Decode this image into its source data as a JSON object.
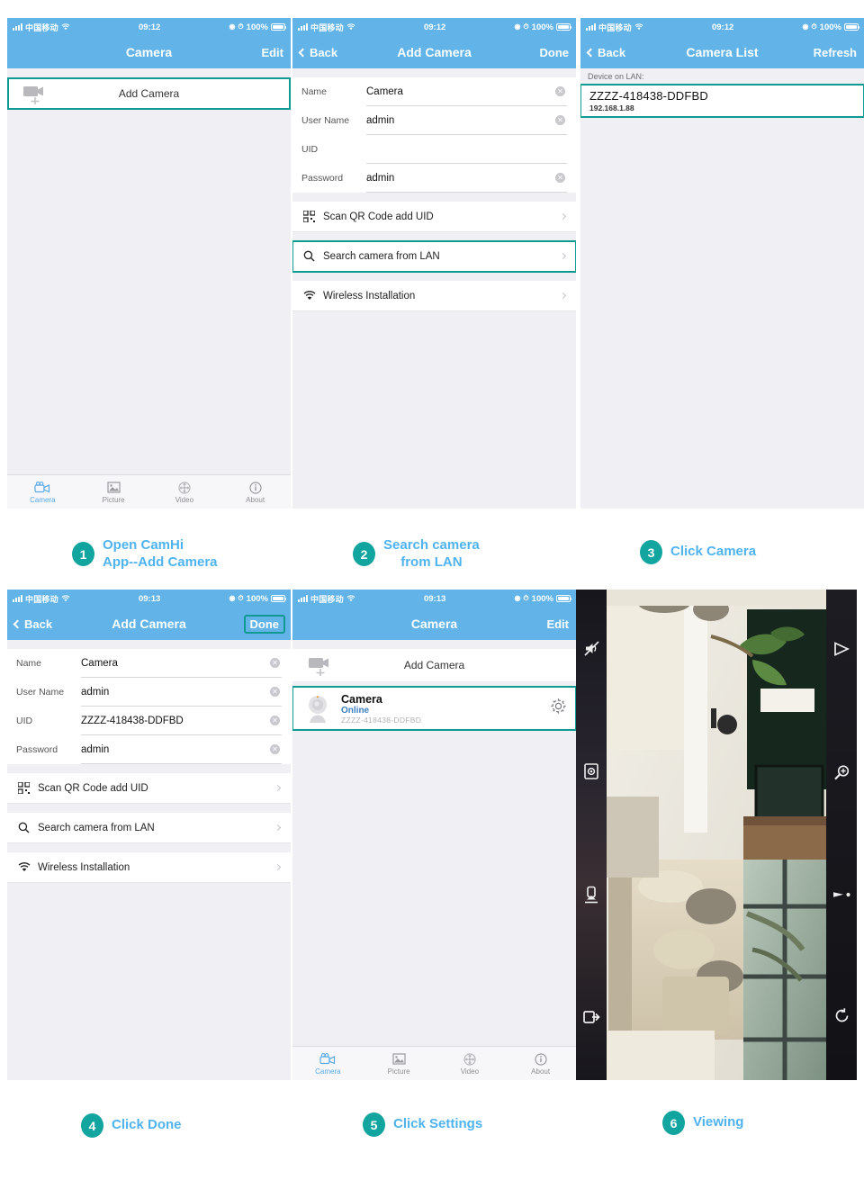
{
  "statusbar": {
    "carrier": "中国移动",
    "time_0912": "09:12",
    "time_0913": "09:13",
    "battery": "100%",
    "signal_icon": "signal-bars-icon",
    "wifi_icon": "wifi-icon",
    "location_icon": "location-icon",
    "alarm_icon": "alarm-icon",
    "battery_icon": "battery-icon"
  },
  "tabbar": {
    "tabs": [
      {
        "label": "Camera",
        "icon": "video-camera-icon",
        "active": true
      },
      {
        "label": "Picture",
        "icon": "photo-icon",
        "active": false
      },
      {
        "label": "Video",
        "icon": "film-reel-icon",
        "active": false
      },
      {
        "label": "About",
        "icon": "info-circle-icon",
        "active": false
      }
    ]
  },
  "panel1": {
    "nav": {
      "title": "Camera",
      "right": "Edit"
    },
    "add_camera_label": "Add Camera"
  },
  "panel2": {
    "nav": {
      "back": "Back",
      "title": "Add Camera",
      "right": "Done"
    },
    "form": [
      {
        "label": "Name",
        "value": "Camera",
        "clear": true
      },
      {
        "label": "User Name",
        "value": "admin",
        "clear": true
      },
      {
        "label": "UID",
        "value": "",
        "clear": false
      },
      {
        "label": "Password",
        "value": "admin",
        "clear": true
      }
    ],
    "menu": [
      {
        "label": "Scan QR Code add UID",
        "icon": "qr-code-icon",
        "highlight": false
      },
      {
        "label": "Search camera from LAN",
        "icon": "search-icon",
        "highlight": true
      },
      {
        "label": "Wireless Installation",
        "icon": "wifi-icon",
        "highlight": false
      }
    ]
  },
  "panel3": {
    "nav": {
      "back": "Back",
      "title": "Camera List",
      "right": "Refresh"
    },
    "section_header": "Device on LAN:",
    "device": {
      "uid": "ZZZZ-418438-DDFBD",
      "ip": "192.168.1.88"
    }
  },
  "panel4": {
    "nav": {
      "back": "Back",
      "title": "Add Camera",
      "right": "Done",
      "right_highlight": true
    },
    "form": [
      {
        "label": "Name",
        "value": "Camera",
        "clear": true
      },
      {
        "label": "User Name",
        "value": "admin",
        "clear": true
      },
      {
        "label": "UID",
        "value": "ZZZZ-418438-DDFBD",
        "clear": true
      },
      {
        "label": "Password",
        "value": "admin",
        "clear": true
      }
    ],
    "menu": [
      {
        "label": "Scan QR Code add UID",
        "icon": "qr-code-icon"
      },
      {
        "label": "Search camera from LAN",
        "icon": "search-icon"
      },
      {
        "label": "Wireless Installation",
        "icon": "wifi-icon"
      }
    ]
  },
  "panel5": {
    "nav": {
      "title": "Camera",
      "right": "Edit"
    },
    "add_camera_label": "Add Camera",
    "camera": {
      "name": "Camera",
      "status": "Online",
      "uid": "ZZZZ-418438-DDFBD",
      "settings_icon": "gear-icon"
    }
  },
  "panel6": {
    "left_controls": [
      {
        "icon": "speaker-mute-icon"
      },
      {
        "icon": "snapshot-icon"
      },
      {
        "icon": "microphone-talk-icon"
      },
      {
        "icon": "exit-arrow-icon"
      }
    ],
    "right_controls": [
      {
        "icon": "play-triangle-icon"
      },
      {
        "icon": "zoom-in-icon"
      },
      {
        "icon": "brightness-slider-icon"
      },
      {
        "icon": "rotate-icon"
      }
    ]
  },
  "steps": [
    {
      "number": "1",
      "text": "Open CamHi\nApp--Add Camera"
    },
    {
      "number": "2",
      "text": "Search camera\nfrom LAN"
    },
    {
      "number": "3",
      "text": "Click Camera"
    },
    {
      "number": "4",
      "text": "Click Done"
    },
    {
      "number": "5",
      "text": "Click Settings"
    },
    {
      "number": "6",
      "text": "Viewing"
    }
  ],
  "colors": {
    "nav_blue": "#62b4e8",
    "highlight_teal": "#0f9a92",
    "badge_teal": "#12a5a0",
    "step_text_blue": "#4fb3ef",
    "status_online": "#3a7fc1"
  }
}
